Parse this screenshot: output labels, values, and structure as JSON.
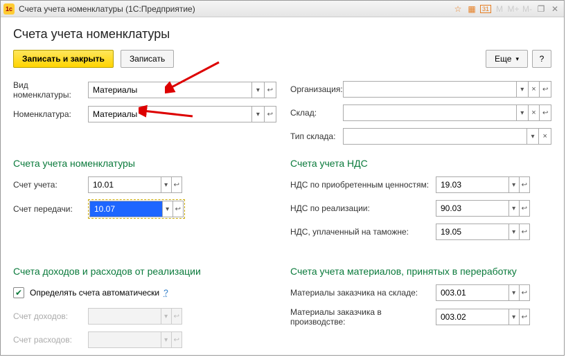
{
  "titlebar": {
    "logo": "1c",
    "title": "Счета учета номенклатуры  (1С:Предприятие)"
  },
  "page_title": "Счета учета номенклатуры",
  "toolbar": {
    "save_close": "Записать и закрыть",
    "save": "Записать",
    "more": "Еще",
    "help": "?"
  },
  "top_left": {
    "nomenclature_type_label": "Вид номенклатуры:",
    "nomenclature_type_value": "Материалы",
    "nomenclature_label": "Номенклатура:",
    "nomenclature_value": "Материалы"
  },
  "top_right": {
    "organization_label": "Организация:",
    "organization_value": "",
    "warehouse_label": "Склад:",
    "warehouse_value": "",
    "warehouse_type_label": "Тип склада:",
    "warehouse_type_value": ""
  },
  "accounts": {
    "section": "Счета учета номенклатуры",
    "account_label": "Счет учета:",
    "account_value": "10.01",
    "transfer_label": "Счет передачи:",
    "transfer_value": "10.07"
  },
  "nds": {
    "section": "Счета учета НДС",
    "purchased_label": "НДС по приобретенным ценностям:",
    "purchased_value": "19.03",
    "sales_label": "НДС по реализации:",
    "sales_value": "90.03",
    "customs_label": "НДС, уплаченный на таможне:",
    "customs_value": "19.05"
  },
  "income": {
    "section": "Счета доходов и расходов от реализации",
    "auto_label": "Определять счета автоматически",
    "auto_hint": "?",
    "income_label": "Счет доходов:",
    "expense_label": "Счет расходов:"
  },
  "materials": {
    "section": "Счета учета материалов, принятых в переработку",
    "in_stock_label": "Материалы заказчика на складе:",
    "in_stock_value": "003.01",
    "in_prod_label": "Материалы заказчика в производстве:",
    "in_prod_value": "003.02"
  }
}
